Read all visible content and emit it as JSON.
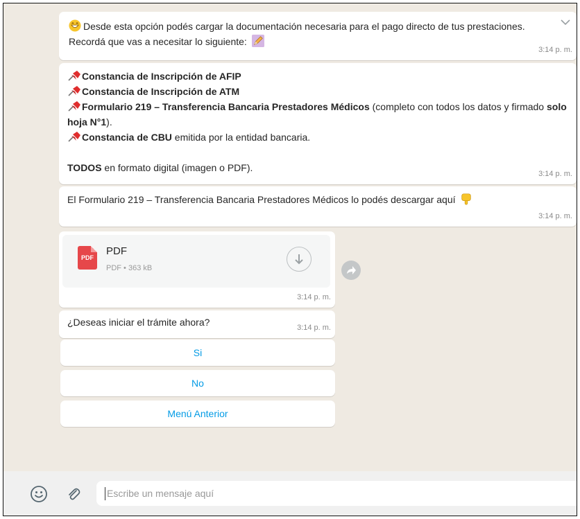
{
  "messages": {
    "intro": {
      "text": "Desde esta opción podés cargar la documentación necesaria para el pago directo de tus prestaciones. Recordá que vas a necesitar lo siguiente:",
      "time": "3:14 p. m."
    },
    "requirements": {
      "item1_bold": "Constancia de Inscripción de AFIP",
      "item2_bold": "Constancia de Inscripción de ATM",
      "item3_bold": "Formulario 219 – Transferencia Bancaria Prestadores Médicos",
      "item3_rest": " (completo con todos los datos y firmado ",
      "item3_bold2": "solo hoja N°1",
      "item3_end": ").",
      "item4_bold": "Constancia de CBU",
      "item4_rest": " emitida por la entidad bancaria.",
      "footer_bold": "TODOS",
      "footer_rest": " en formato digital (imagen o PDF).",
      "time": "3:14 p. m."
    },
    "download": {
      "text": "El Formulario 219 – Transferencia Bancaria Prestadores Médicos lo podés descargar aquí",
      "time": "3:14 p. m."
    },
    "document": {
      "icon_label": "PDF",
      "name": "PDF",
      "meta": "PDF • 363 kB",
      "time": "3:14 p. m."
    },
    "question": {
      "text": "¿Deseas iniciar el trámite ahora?",
      "time": "3:14 p. m."
    }
  },
  "quick_replies": [
    "Si",
    "No",
    "Menú Anterior"
  ],
  "composer": {
    "placeholder": "Escribe un mensaje aquí",
    "emoji_icon": "emoji-icon",
    "attach_icon": "paperclip-icon"
  },
  "colors": {
    "chat_bg": "#efeae2",
    "bubble": "#ffffff",
    "link_blue": "#039be5",
    "pdf_red": "#e6474a"
  }
}
